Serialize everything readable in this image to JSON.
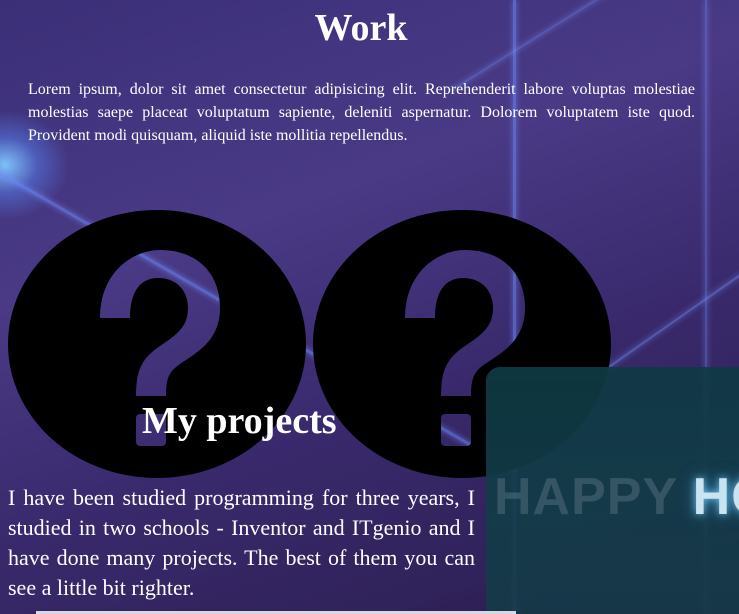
{
  "work": {
    "title": "Work",
    "text": "Lorem ipsum, dolor sit amet consectetur adipisicing elit. Reprehenderit labore voluptas molestiae molestias saepe placeat voluptatum sapiente, deleniti aspernatur. Dolorem voluptatem iste quod. Provident modi quisquam, aliquid iste mollitia repellendus."
  },
  "projects": {
    "title": "My projects",
    "text": "I have been studied programming for three years, I studied in two schools - Inventor and ITgenio and I have done many projects. The best of them you can see a little bit righter."
  },
  "icons": {
    "first": "question-circle-icon",
    "second": "question-circle-icon"
  },
  "preview": {
    "dim_text": "HAPPY ",
    "bright_text": "HOL"
  },
  "colors": {
    "background": "#3b2f78",
    "icon_fill": "#000000",
    "text": "#ffffff",
    "preview_bg": "#0f3a44",
    "preview_glow": "#d8f4ff"
  }
}
